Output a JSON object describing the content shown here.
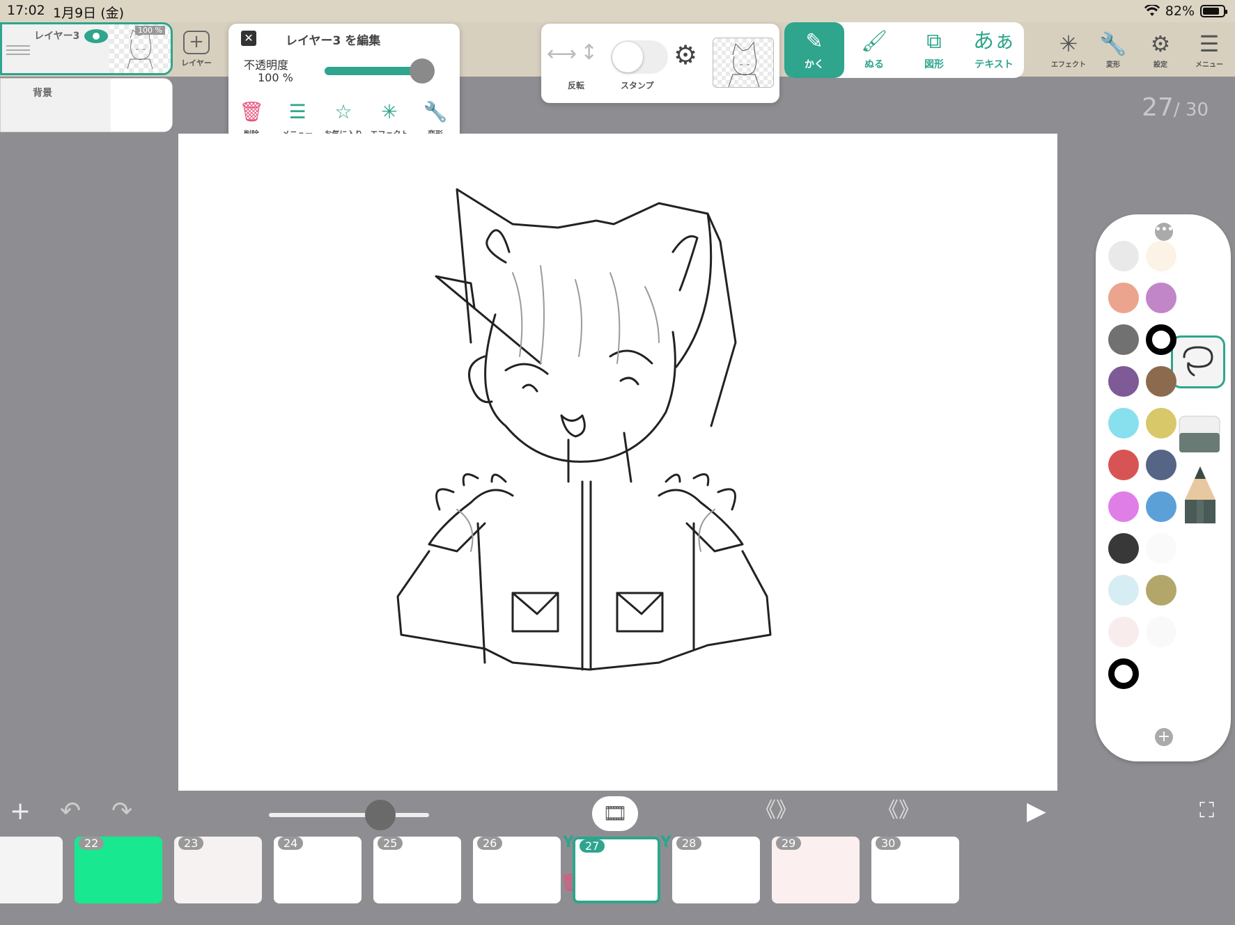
{
  "status_bar": {
    "time": "17:02",
    "date": "1月9日 (金)",
    "battery": "82%",
    "battery_level": 0.82
  },
  "layers": {
    "active": {
      "name": "レイヤー3",
      "opacity": "100 %"
    },
    "background": {
      "name": "背景"
    },
    "add_label": "レイヤー"
  },
  "edit_panel": {
    "title": "レイヤー3 を編集",
    "opacity_label": "不透明度",
    "opacity_value": "100 %",
    "opacity_level": 1.0,
    "actions": [
      {
        "label": "削除",
        "icon": "trash-icon"
      },
      {
        "label": "メニュー",
        "icon": "menu-icon"
      },
      {
        "label": "お気に入り",
        "icon": "star-icon"
      },
      {
        "label": "エフェクト",
        "icon": "sparkle-icon"
      },
      {
        "label": "変形",
        "icon": "wrench-icon"
      }
    ]
  },
  "stamp_panel": {
    "flip_label": "反転",
    "stamp_label": "スタンプ",
    "stamp_enabled": false
  },
  "tools": [
    {
      "label": "かく",
      "icon": "pen-icon",
      "active": true
    },
    {
      "label": "ぬる",
      "icon": "brush-icon",
      "active": false
    },
    {
      "label": "図形",
      "icon": "shape-icon",
      "active": false
    },
    {
      "label": "テキスト",
      "icon": "text-icon",
      "glyph": "あぁ",
      "active": false
    }
  ],
  "right_menu": [
    {
      "label": "エフェクト",
      "icon": "sparkle-icon"
    },
    {
      "label": "変形",
      "icon": "wrench-icon"
    },
    {
      "label": "設定",
      "icon": "gear-icon"
    },
    {
      "label": "メニュー",
      "icon": "hamburger-icon"
    }
  ],
  "frame_counter": {
    "current": "27",
    "total": "/ 30"
  },
  "palette": {
    "colors": [
      "#e9e9e9",
      "#fbf3e6",
      "#eba58e",
      "#c086c8",
      "#717171",
      "#000000",
      "#7e5a96",
      "#8c6a4e",
      "#88e0ee",
      "#d8c86a",
      "#d85454",
      "#566486",
      "#e07ee8",
      "#5ca0d8",
      "#383838",
      "#fafafa",
      "#d6edf3",
      "#b2a66a",
      "#f9ecec",
      "#f9f9f9",
      "#000000"
    ],
    "selected_index": [
      5,
      20
    ],
    "accent": "#2ea58c"
  },
  "timeline": {
    "zoom_level": 0.72,
    "frames": [
      {
        "num": "",
        "bg": "#f4f4f4"
      },
      {
        "num": "22",
        "bg": "#18e890"
      },
      {
        "num": "23",
        "bg": "#f7f2f2"
      },
      {
        "num": "24",
        "bg": "#ffffff"
      },
      {
        "num": "25",
        "bg": "#ffffff"
      },
      {
        "num": "26",
        "bg": "#ffffff"
      },
      {
        "num": "27",
        "bg": "#ffffff",
        "active": true
      },
      {
        "num": "28",
        "bg": "#ffffff"
      },
      {
        "num": "29",
        "bg": "#fbefef"
      },
      {
        "num": "30",
        "bg": "#ffffff"
      }
    ]
  }
}
